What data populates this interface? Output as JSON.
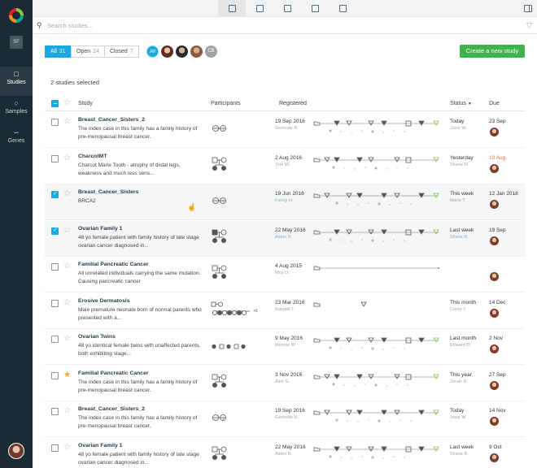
{
  "sidebar": {
    "org_initials": "SF",
    "items": [
      {
        "label": "Studies",
        "icon": "folder-icon",
        "active": true
      },
      {
        "label": "Samples",
        "icon": "person-icon",
        "active": false
      },
      {
        "label": "Genes",
        "icon": "dna-icon",
        "active": false
      }
    ]
  },
  "search": {
    "placeholder": "Search studies..."
  },
  "filters": {
    "segments": [
      {
        "label": "All",
        "count": "31",
        "active": true
      },
      {
        "label": "Open",
        "count": "24",
        "active": false
      },
      {
        "label": "Closed",
        "count": "7",
        "active": false
      }
    ],
    "people": {
      "all_label": "All",
      "initials_label": "CB"
    }
  },
  "create_button": "Create a new study",
  "selected_text": "2 studies selected",
  "columns": {
    "study": "Study",
    "participants": "Participants",
    "registered": "Registered",
    "status": "Status",
    "due": "Due"
  },
  "colors": {
    "accent": "#1aa8e0",
    "create": "#3cb44b",
    "overdue": "#e8663c",
    "timeline_done": "#8cc63f"
  },
  "rows": [
    {
      "checked": false,
      "starred": false,
      "selected": false,
      "title": "Breast_Cancer_Sisters_2",
      "desc": "The index case in this family has a family history of  pre-menopausal breast cancer.",
      "registered": "19 Sep 2016",
      "registered_by": "Gertrude R.",
      "status": "Today",
      "status_by": "Josie W.",
      "due": "23 Sep",
      "overdue": false
    },
    {
      "checked": false,
      "starred": false,
      "selected": false,
      "title": "CharcotMT",
      "desc": "Charcot Marie Tooth - atrophy of distal legs, weakness and much less sens...",
      "registered": "2 Aug 2016",
      "registered_by": "Tom W.",
      "status": "Yesterday",
      "status_by": "Shane M.",
      "due": "10 Aug",
      "overdue": true
    },
    {
      "checked": true,
      "starred": false,
      "selected": true,
      "title": "Breast_Cancer_Sisters",
      "desc": "BRCA2",
      "registered": "19 Jun 2016",
      "registered_by": "Fanny H.",
      "status": "This week",
      "status_by": "Marie T.",
      "due": "12 Jan 2018",
      "overdue": false
    },
    {
      "checked": true,
      "starred": false,
      "selected": true,
      "title": "Ovarian Family 1",
      "desc": "48 yo female patient with family history of late stage ovarian cancer diagnosed in...",
      "registered": "22 May 2016",
      "registered_by": "Alden R.",
      "status": "Last week",
      "status_by": "Shane R.",
      "due": "19 Sep",
      "overdue": false
    },
    {
      "checked": false,
      "starred": false,
      "selected": false,
      "title": "Familial Pancreatic Cancer",
      "desc": "All unrelated individuals carrying the same mutation. Causing pancreatic cancer",
      "registered": "4 Aug 2015",
      "registered_by": "Moy O.",
      "status": "",
      "status_by": "",
      "due": "",
      "overdue": false
    },
    {
      "checked": false,
      "starred": false,
      "selected": false,
      "title": "Erosive Dermatosis",
      "desc": "Male premature neonate born of normal parents who presented with a...",
      "registered": "23 Mar 2016",
      "registered_by": "Randall T.",
      "status": "This month",
      "status_by": "Corey T.",
      "due": "14 Dec",
      "overdue": false
    },
    {
      "checked": false,
      "starred": false,
      "selected": false,
      "title": "Ovarian Twins",
      "desc": "48 yo identical female twins with unaffected parents, both exhibiting stage...",
      "registered": "9 May 2016",
      "registered_by": "Mennie W.",
      "status": "Last month",
      "status_by": "Edward O.",
      "due": "2 Nov",
      "overdue": false
    },
    {
      "checked": false,
      "starred": true,
      "selected": false,
      "title": "Familial Pancreatic Cancer",
      "desc": "The index case in this family has a family history of  pre-menopausal breast cancer.",
      "registered": "3 Nov 2016",
      "registered_by": "Alex S.",
      "status": "This year",
      "status_by": "Jonah H.",
      "due": "27 Sep",
      "overdue": false
    },
    {
      "checked": false,
      "starred": false,
      "selected": false,
      "title": "Breast_Cancer_Sisters_2",
      "desc": "The index case in this family has a family history of  pre-menopausal breast cancer.",
      "registered": "19 Sep 2016",
      "registered_by": "Gertrude R.",
      "status": "Today",
      "status_by": "Josie W.",
      "due": "14 Nov",
      "overdue": false
    },
    {
      "checked": false,
      "starred": false,
      "selected": false,
      "title": "Ovarian Family 1",
      "desc": "48 yo female patient with family history of late stage ovarian cancer diagnosed in...",
      "registered": "22 May 2016",
      "registered_by": "Alden R.",
      "status": "Last week",
      "status_by": "Shane R.",
      "due": "9 Oct",
      "overdue": false
    }
  ],
  "extra_plus": "+6"
}
